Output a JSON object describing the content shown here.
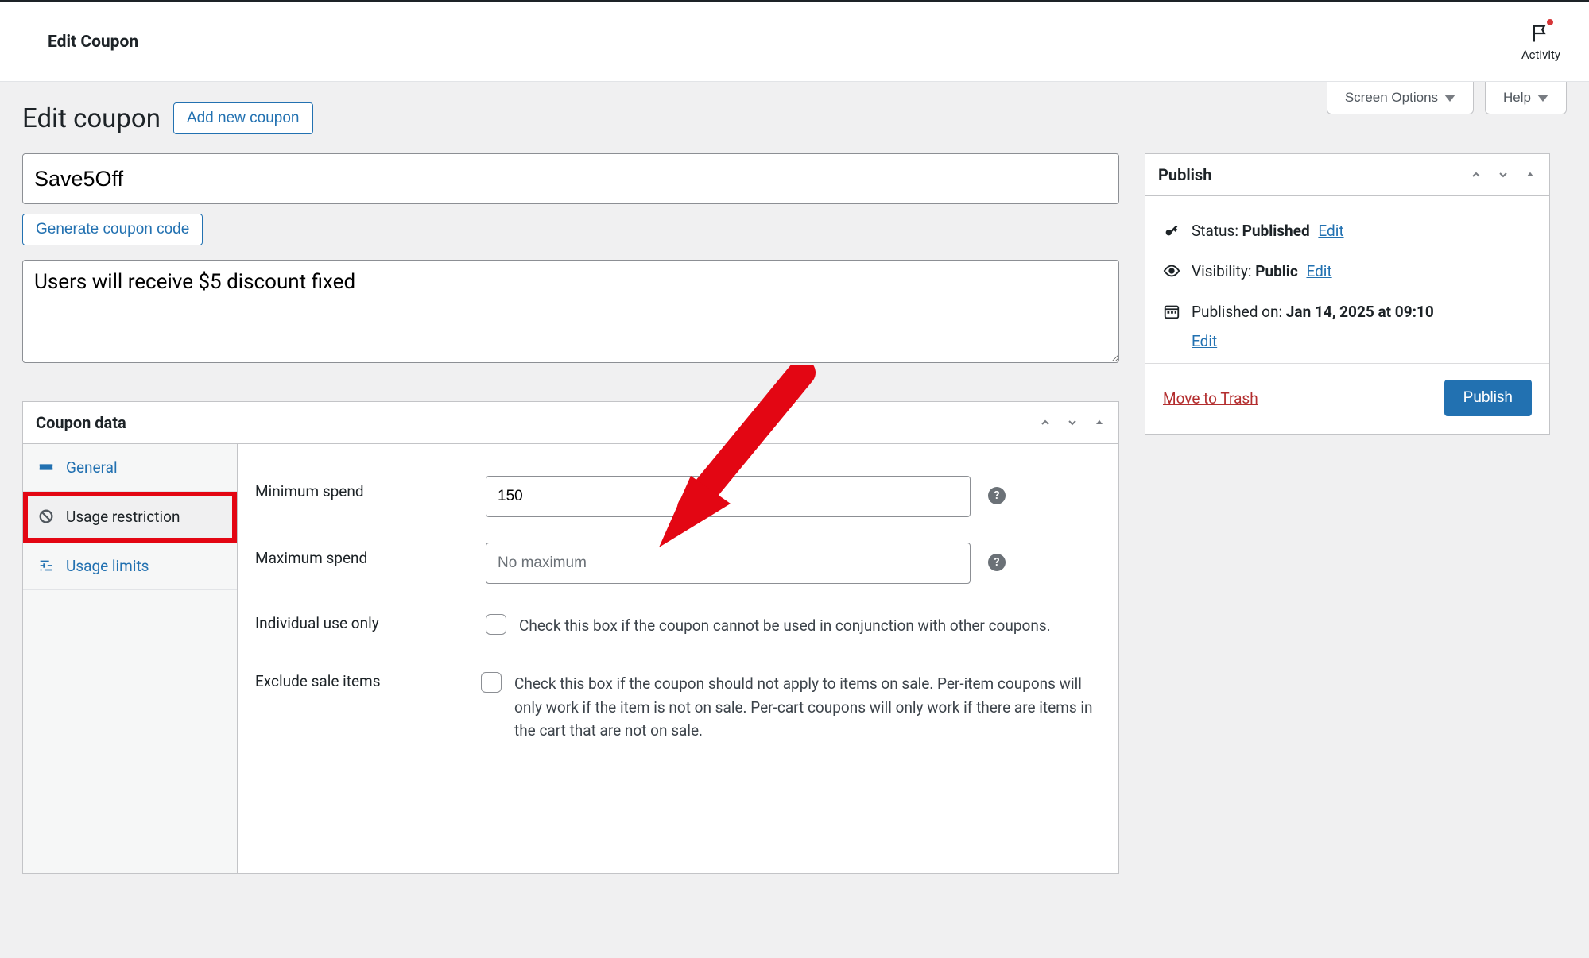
{
  "adminbar": {
    "title": "Edit Coupon",
    "activity_label": "Activity"
  },
  "screen_meta": {
    "screen_options": "Screen Options",
    "help": "Help"
  },
  "page": {
    "title": "Edit coupon",
    "add_new_label": "Add new coupon",
    "coupon_code": "Save5Off",
    "generate_code_label": "Generate coupon code",
    "description": "Users will receive $5 discount fixed"
  },
  "coupon_data": {
    "panel_title": "Coupon data",
    "tabs": {
      "general": "General",
      "usage_restriction": "Usage restriction",
      "usage_limits": "Usage limits"
    },
    "fields": {
      "min_spend_label": "Minimum spend",
      "min_spend_value": "150",
      "max_spend_label": "Maximum spend",
      "max_spend_placeholder": "No maximum",
      "individual_use_label": "Individual use only",
      "individual_use_desc": "Check this box if the coupon cannot be used in conjunction with other coupons.",
      "exclude_sale_label": "Exclude sale items",
      "exclude_sale_desc": "Check this box if the coupon should not apply to items on sale. Per-item coupons will only work if the item is not on sale. Per-cart coupons will only work if there are items in the cart that are not on sale."
    }
  },
  "publish": {
    "panel_title": "Publish",
    "status_label": "Status:",
    "status_value": "Published",
    "visibility_label": "Visibility:",
    "visibility_value": "Public",
    "published_on_label": "Published on:",
    "published_on_value": "Jan 14, 2025 at 09:10",
    "edit_label": "Edit",
    "trash_label": "Move to Trash",
    "publish_button": "Publish"
  }
}
